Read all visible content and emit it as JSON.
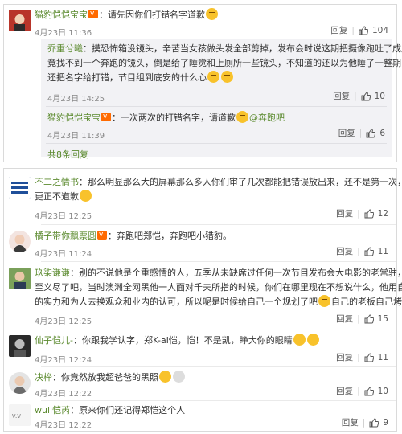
{
  "thread": {
    "main": {
      "username": "猫豹恺恺宝宝",
      "text": "：请先因你们打错名字道歉",
      "time": "4月23日 11:36",
      "reply_label": "回复",
      "likes": "104"
    },
    "replies": [
      {
        "username": "乔重兮曦",
        "text_lines": [
          "：摸恐怖箱没镜头，辛苦当女孩做头发全部剪掉，发布会时说这期把摄像跑吐了成片",
          "竟找不到一个奔跑的镜头，倒是给了睡觉和上厕所一些镜头，不知道的还以为他睡了一整期，",
          "还把名字给打错，节目组到底安的什么心"
        ],
        "time": "4月23日 14:25",
        "reply_label": "回复",
        "likes": "10"
      },
      {
        "username": "猫豹恺恺宝宝",
        "text": "：一次两次的打错名字，请道歉",
        "mention": "@奔跑吧",
        "time": "4月23日 11:39",
        "reply_label": "回复",
        "likes": "6"
      }
    ],
    "more_replies": "共8条回复"
  },
  "comments": [
    {
      "username": "不二之情书",
      "text_lines": [
        "：那么明显那么大的屏幕那么多人你们审了几次都能把错误放出来，还不是第一次，不",
        "更正不道歉"
      ],
      "time": "4月23日 12:25",
      "reply_label": "回复",
      "likes": "12"
    },
    {
      "username": "橘子带你飘票圆",
      "text_lines": [
        "：奔跑吧郑恺，奔跑吧小猎豹。"
      ],
      "time": "4月23日 11:24",
      "reply_label": "回复",
      "likes": "11"
    },
    {
      "username": "玖柒谦谦",
      "text_lines": [
        "：别的不说他是个重感情的人，五季从未缺席过任何一次节目发布会大电影的老常驻，仁",
        "至义尽了吧，当时澳洲全网黑他一人面对千夫所指的时候，你们在哪里现在不想说什么，他用自己",
        "的实力和为人去换观众和业内的认可，所以呢是时候给自己一个规划了吧",
        "自己的老板自己烤"
      ],
      "time": "4月23日 12:25",
      "reply_label": "回复",
      "likes": "15"
    },
    {
      "username": "仙子恺儿-",
      "text_lines": [
        "：你跟我学认字，郑K-ai恺，恺！不是凯，睁大你的眼睛"
      ],
      "time": "4月23日 12:24",
      "reply_label": "回复",
      "likes": "11"
    },
    {
      "username": "决榉",
      "text_lines": [
        "：你竟然放我超爸爸的黑照"
      ],
      "time": "4月23日 12:22",
      "reply_label": "回复",
      "likes": "10"
    },
    {
      "username": "wuli恺芮",
      "text_lines": [
        "：原来你们还记得郑恺这个人"
      ],
      "time": "4月23日 12:22",
      "reply_label": "回复",
      "likes": "9"
    }
  ],
  "colors": {
    "username": "#5b8a2e",
    "reply_bg": "#f2f2f5",
    "badge": "#ff6a00"
  }
}
